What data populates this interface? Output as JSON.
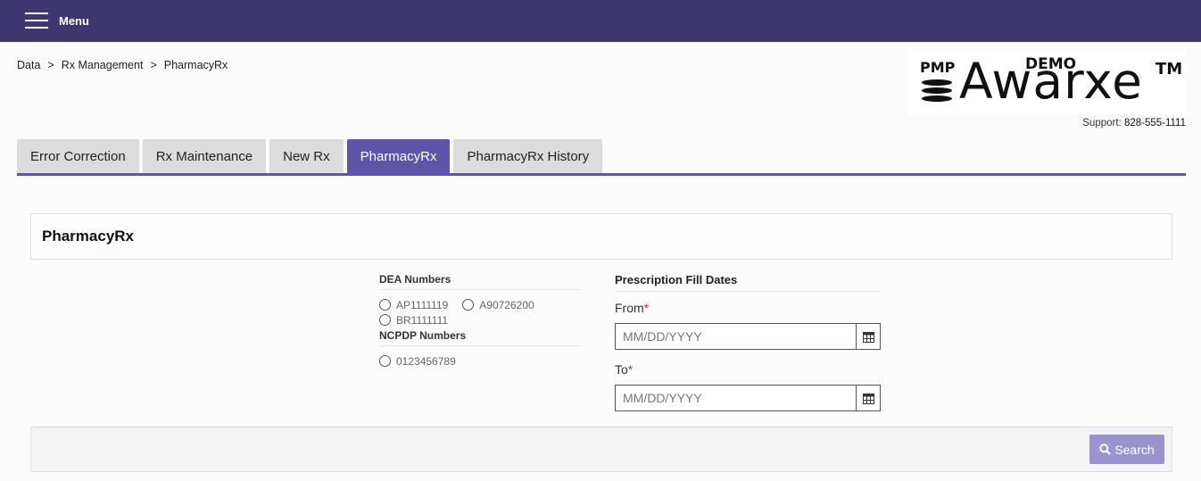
{
  "header": {
    "menu_label": "Menu"
  },
  "breadcrumb": {
    "items": [
      "Data",
      "Rx Management",
      "PharmacyRx"
    ],
    "separator": ">"
  },
  "logo": {
    "pmp": "PMP",
    "demo": "DEMO",
    "name": "Awarxe",
    "tm": "TM"
  },
  "support": {
    "label": "Support:",
    "phone": "828-555-1111"
  },
  "tabs": [
    {
      "label": "Error Correction",
      "active": false
    },
    {
      "label": "Rx Maintenance",
      "active": false
    },
    {
      "label": "New Rx",
      "active": false
    },
    {
      "label": "PharmacyRx",
      "active": true
    },
    {
      "label": "PharmacyRx History",
      "active": false
    }
  ],
  "panel": {
    "title": "PharmacyRx"
  },
  "dea": {
    "title": "DEA Numbers",
    "options": [
      "AP1111119",
      "A90726200",
      "BR1111111"
    ]
  },
  "ncpdp": {
    "title": "NCPDP Numbers",
    "options": [
      "0123456789"
    ]
  },
  "dates": {
    "title": "Prescription Fill Dates",
    "from_label": "From",
    "to_label": "To",
    "required_mark": "*",
    "from_placeholder": "MM/DD/YYYY",
    "to_placeholder": "MM/DD/YYYY",
    "from_value": "",
    "to_value": ""
  },
  "actions": {
    "search_label": "Search"
  },
  "colors": {
    "topbar": "#3e3770",
    "accent": "#5e54a8",
    "search_button": "#9b93cf",
    "required": "#c0392b"
  }
}
